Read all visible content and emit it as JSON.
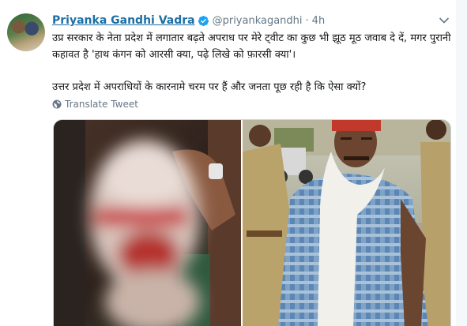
{
  "tweet": {
    "author_name": "Priyanka Gandhi Vadra",
    "handle": "@priyankagandhi",
    "separator": "·",
    "time": "4h",
    "text_paragraph_1": "उप्र सरकार के नेता प्रदेश में लगातार बढ़ते अपराध पर मेरे ट्वीट का कुछ भी झूठ मूठ जवाब दे दें, मगर पुरानी कहावत है 'हाथ कंगन को आरसी क्या, पढ़े लिखे को फ़ारसी क्या'।",
    "text_paragraph_2": "उत्तर प्रदेश में अपराधियों के कारनामे चरम पर हैं और जनता पूछ रही है कि ऐसा क्यों?",
    "translate_label": "Translate Tweet"
  },
  "colors": {
    "name": "#1d6fa5",
    "verified": "#1da1f2",
    "muted": "#657786",
    "text": "#14171a"
  },
  "icons": {
    "verified": "verified-badge-icon",
    "menu": "chevron-down-icon",
    "translate": "globe-icon"
  }
}
